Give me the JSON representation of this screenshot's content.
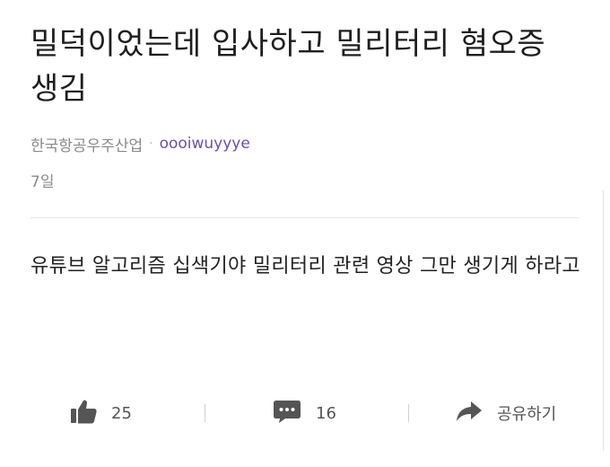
{
  "post": {
    "title": "밀덕이었는데 입사하고 밀리터리 혐오증 생김",
    "company": "한국항공우주산업",
    "separator": "·",
    "author": "oooiwuyyye",
    "time_ago": "7일",
    "content": "유튜브 알고리즘 십색기야 밀리터리 관련 영상 그만 생기게 하라고"
  },
  "actions": {
    "like_count": "25",
    "comment_count": "16",
    "share_label": "공유하기",
    "icons": {
      "like": "thumbs-up-icon",
      "comment": "speech-bubble-icon",
      "share": "share-arrow-icon"
    }
  },
  "colors": {
    "author": "#6a4fb0",
    "meta": "#8a8a8a",
    "text": "#222222",
    "icon": "#555555"
  }
}
